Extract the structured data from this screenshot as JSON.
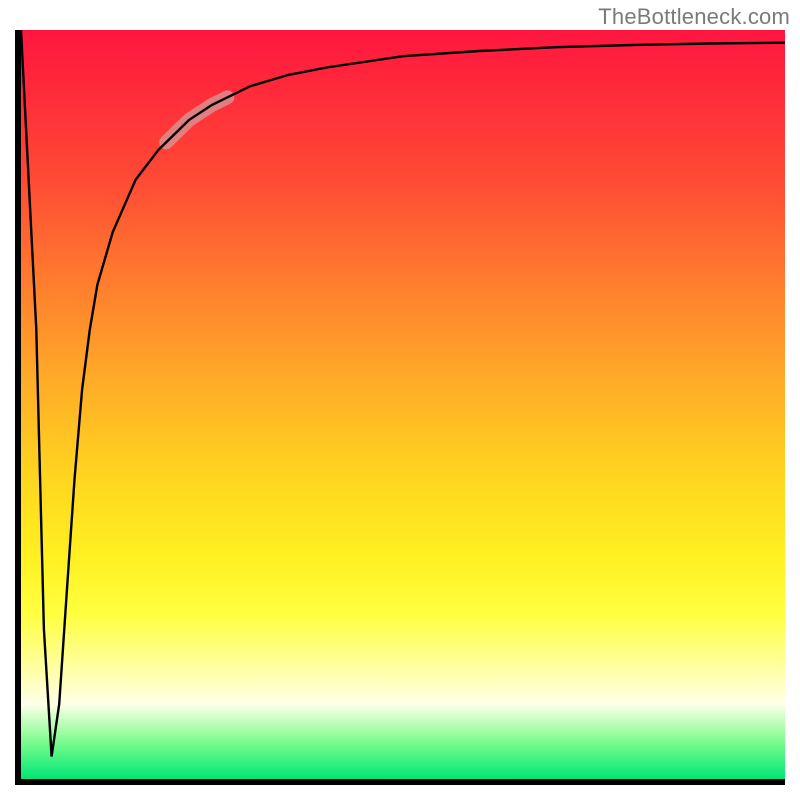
{
  "watermark": "TheBottleneck.com",
  "colors": {
    "watermark": "#7a7a7a",
    "axis": "#000000",
    "curve": "#000000",
    "highlight": "rgba(213,154,154,0.75)",
    "gradient_stops": [
      "#ff1640",
      "#ff2a3a",
      "#ff4a34",
      "#ff7a2e",
      "#ffa529",
      "#ffd020",
      "#fff020",
      "#ffff40",
      "#ffffa0",
      "#ffffe8",
      "#7cfc8e",
      "#00e676"
    ]
  },
  "chart_data": {
    "type": "line",
    "title": "",
    "xlabel": "",
    "ylabel": "",
    "xlim": [
      0,
      100
    ],
    "ylim": [
      0,
      100
    ],
    "grid": false,
    "legend": false,
    "x": [
      0,
      2,
      3,
      4,
      5,
      6,
      7,
      8,
      9,
      10,
      12,
      15,
      18,
      20,
      22,
      25,
      30,
      35,
      40,
      50,
      60,
      70,
      80,
      90,
      100
    ],
    "values": [
      100,
      60,
      20,
      3,
      10,
      25,
      40,
      52,
      60,
      66,
      73,
      80,
      84,
      86,
      88,
      90,
      92.5,
      94,
      95,
      96.5,
      97.2,
      97.7,
      98,
      98.2,
      98.3
    ],
    "series": [
      {
        "name": "bottleneck-curve",
        "x": [
          0,
          2,
          3,
          4,
          5,
          6,
          7,
          8,
          9,
          10,
          12,
          15,
          18,
          20,
          22,
          25,
          30,
          35,
          40,
          50,
          60,
          70,
          80,
          90,
          100
        ],
        "y": [
          100,
          60,
          20,
          3,
          10,
          25,
          40,
          52,
          60,
          66,
          73,
          80,
          84,
          86,
          88,
          90,
          92.5,
          94,
          95,
          96.5,
          97.2,
          97.7,
          98,
          98.2,
          98.3
        ]
      }
    ],
    "highlight_range_x": [
      19,
      27
    ],
    "annotations": []
  }
}
